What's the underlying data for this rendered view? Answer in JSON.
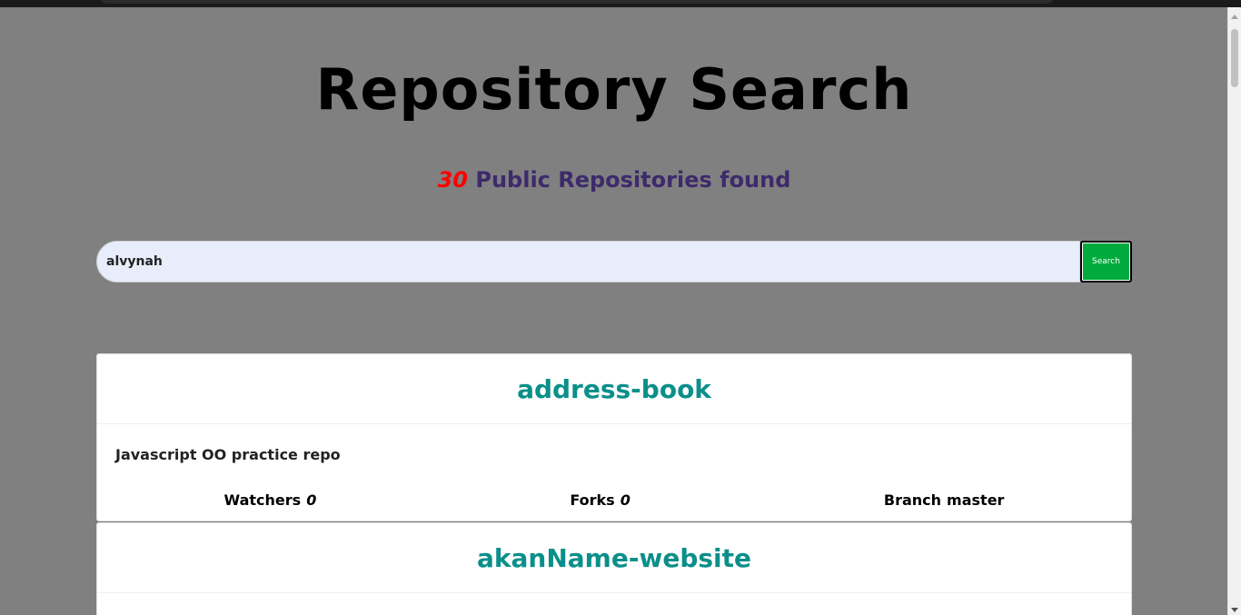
{
  "page": {
    "title": "Repository Search",
    "count": "30",
    "count_suffix": " Public Repositories found"
  },
  "search": {
    "value": "alvynah",
    "button_label": "Search"
  },
  "repos": [
    {
      "name": "address-book",
      "description": "Javascript OO practice repo",
      "watchers_label": "Watchers",
      "watchers": "0",
      "forks_label": "Forks",
      "forks": "0",
      "branch_label": "Branch",
      "branch": "master"
    },
    {
      "name": "akanName-website"
    }
  ],
  "colors": {
    "background": "#808080",
    "count": "#ff0000",
    "count_text": "#3d2a6b",
    "repo_name": "#0b8f8a",
    "search_button": "#00aa3c",
    "input_bg": "#e8edfb"
  }
}
